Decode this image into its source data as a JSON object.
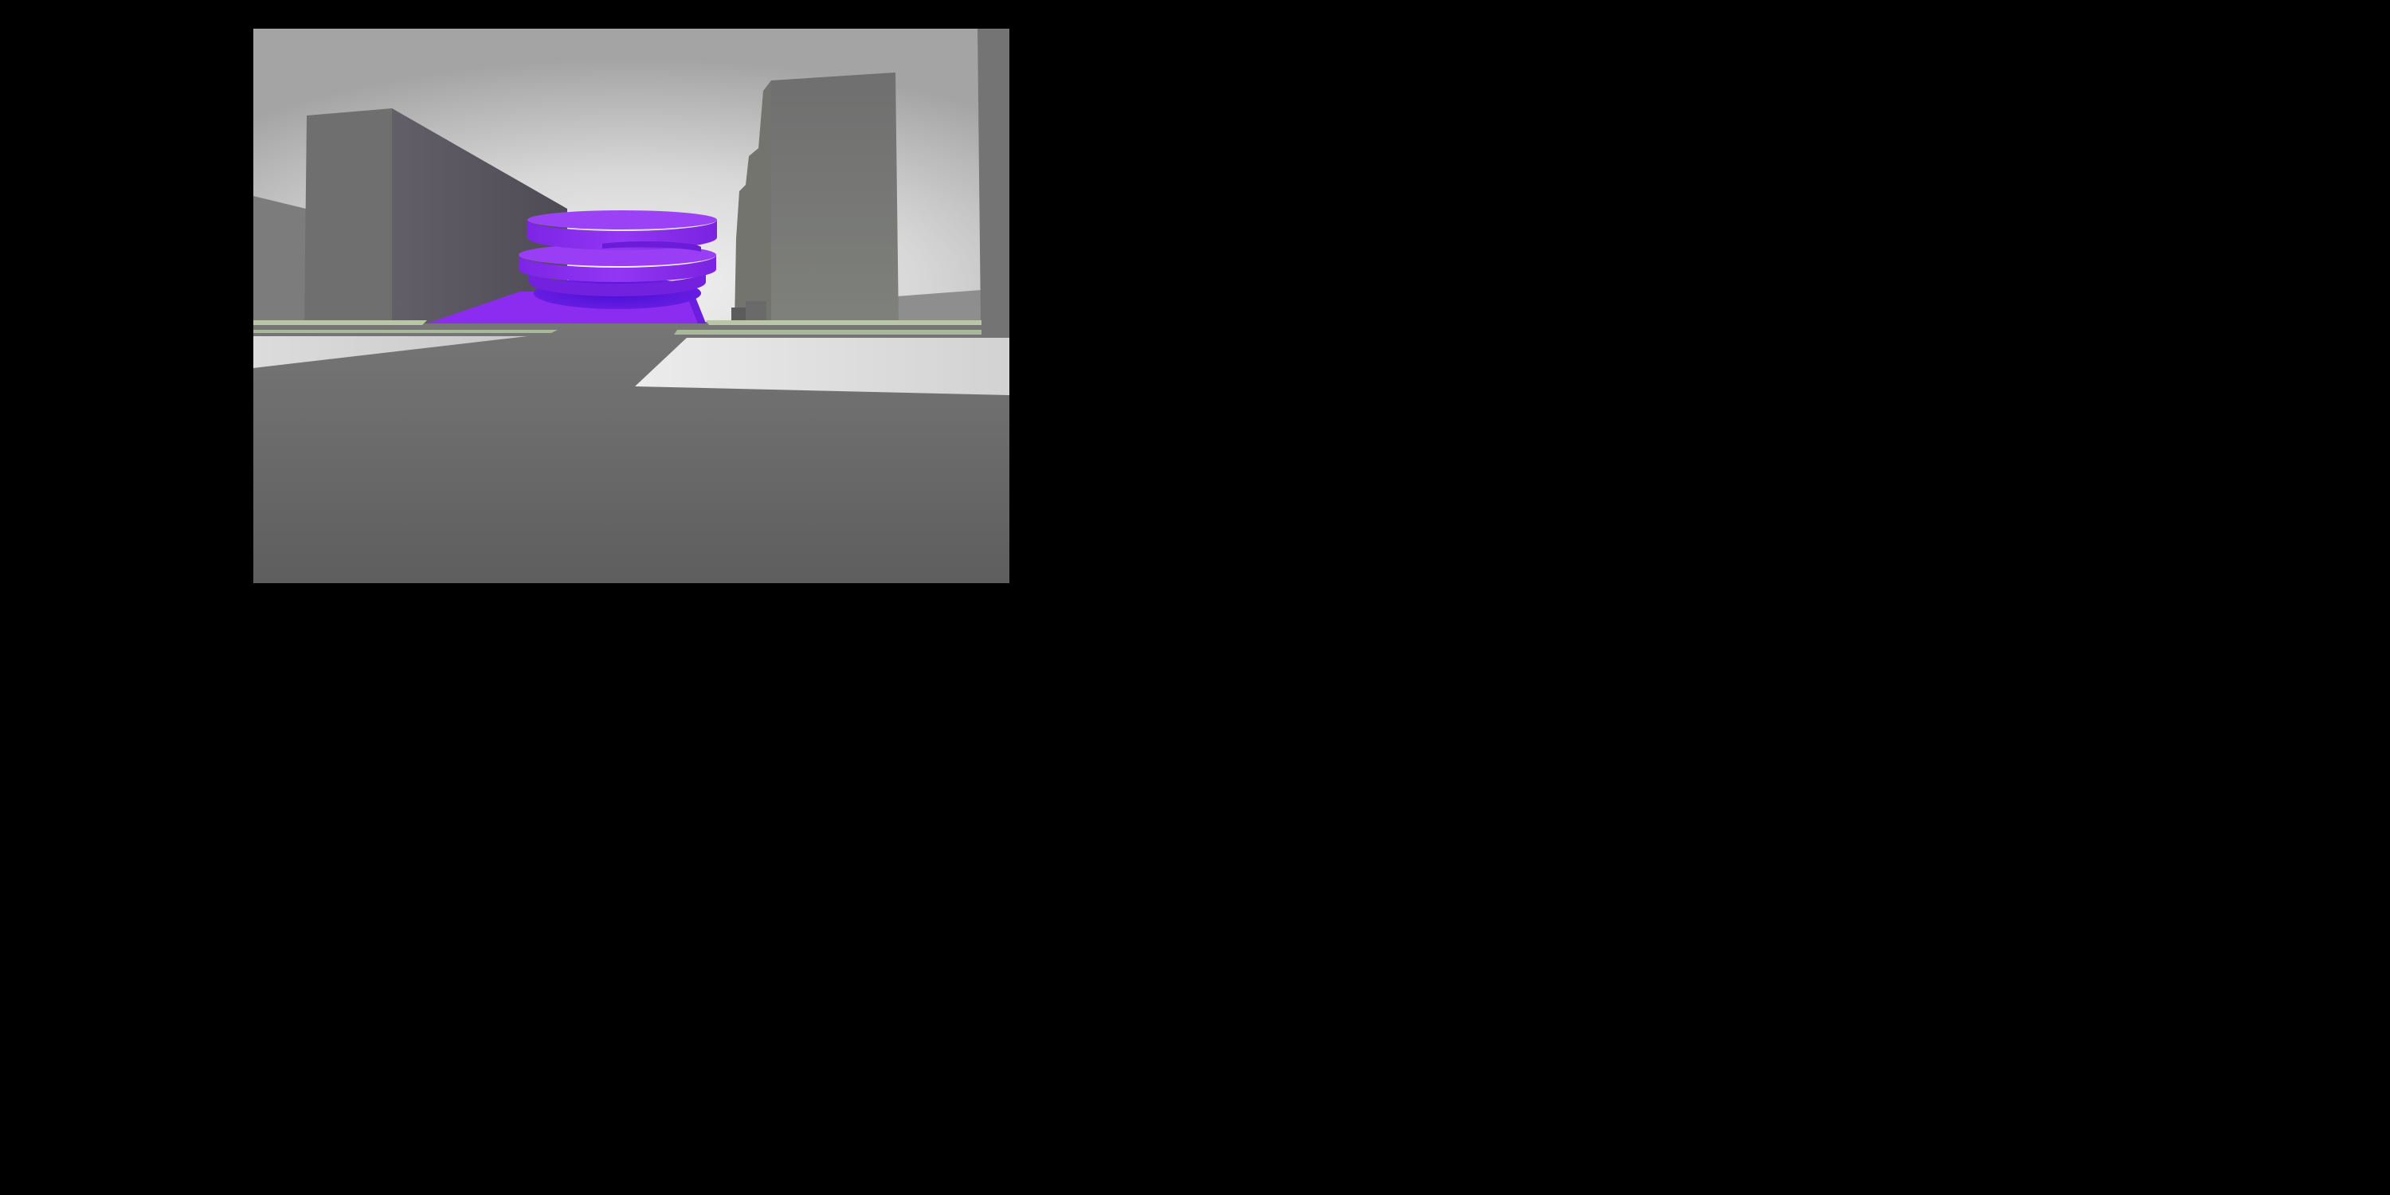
{
  "scene": {
    "subject": "massing-render-street-view",
    "colors": {
      "background_frame": "#000000",
      "sky_top": "#9c9c9c",
      "sky_horizon": "#ececec",
      "ground": "#6c6c6c",
      "plaza_light": "#e2e2e2",
      "building_front": "#6e6e6e",
      "building_side": "#5f5c66",
      "building_right": "#7a7c78",
      "accent_purple": "#8b2cf0",
      "accent_purple_dark": "#5a12d8",
      "curb_green": "#b9c7a6"
    },
    "elements": [
      "left-tall-building",
      "left-distant-building",
      "purple-spiral-building",
      "purple-podium",
      "right-tall-building",
      "right-edge-building",
      "distant-low-building",
      "road-surface",
      "left-plaza",
      "right-plaza",
      "curb-strips"
    ]
  }
}
